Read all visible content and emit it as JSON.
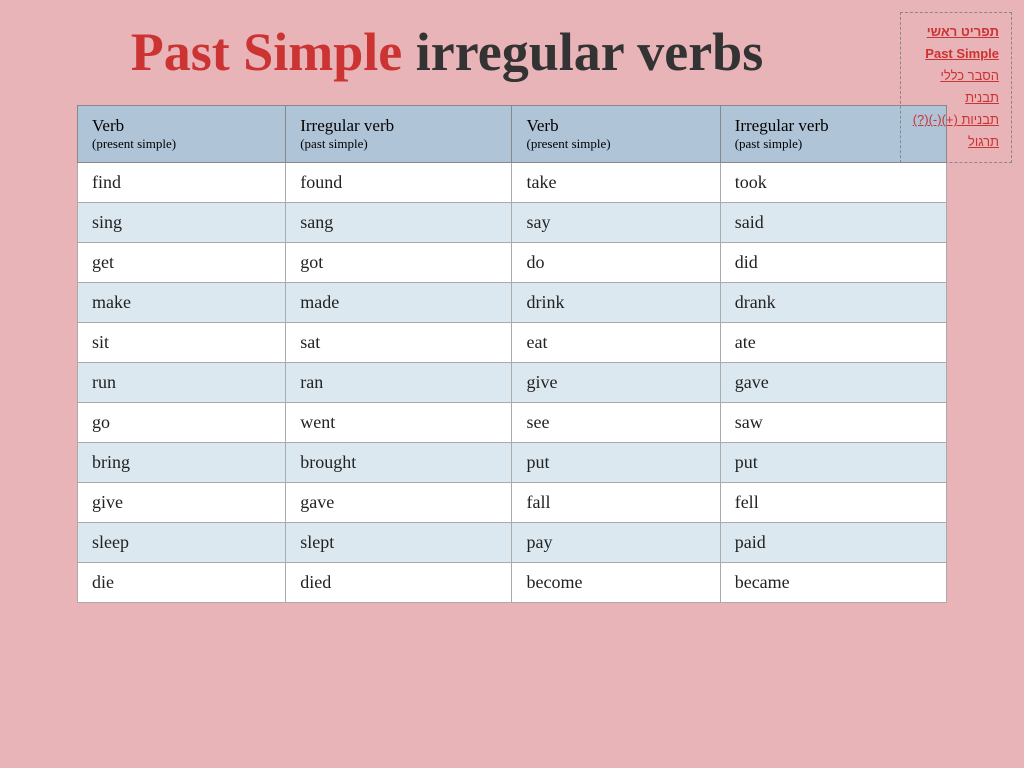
{
  "nav": {
    "items": [
      {
        "label": "תפריט ראשי",
        "class": "active"
      },
      {
        "label": "Past Simple",
        "class": "active"
      },
      {
        "label": "הסבר כללי",
        "class": "normal"
      },
      {
        "label": "תבנית",
        "class": "normal"
      },
      {
        "label": "תבניות (+)(-)(?)",
        "class": "normal"
      },
      {
        "label": "תרגול",
        "class": "normal"
      }
    ]
  },
  "title": {
    "part1": "Past Simple",
    "part2": " irregular verbs"
  },
  "table": {
    "headers": [
      {
        "main": "Verb",
        "sub": "(present simple)"
      },
      {
        "main": "Irregular verb",
        "sub": "(past simple)"
      },
      {
        "main": "Verb",
        "sub": "(present simple)"
      },
      {
        "main": "Irregular verb",
        "sub": "(past simple)"
      }
    ],
    "rows": [
      [
        "find",
        "found",
        "take",
        "took"
      ],
      [
        "sing",
        "sang",
        "say",
        "said"
      ],
      [
        "get",
        "got",
        "do",
        "did"
      ],
      [
        "make",
        "made",
        "drink",
        "drank"
      ],
      [
        "sit",
        "sat",
        "eat",
        "ate"
      ],
      [
        "run",
        "ran",
        "give",
        "gave"
      ],
      [
        "go",
        "went",
        "see",
        "saw"
      ],
      [
        "bring",
        "brought",
        "put",
        "put"
      ],
      [
        "give",
        "gave",
        "fall",
        "fell"
      ],
      [
        "sleep",
        "slept",
        "pay",
        "paid"
      ],
      [
        "die",
        "died",
        "become",
        "became"
      ]
    ]
  }
}
